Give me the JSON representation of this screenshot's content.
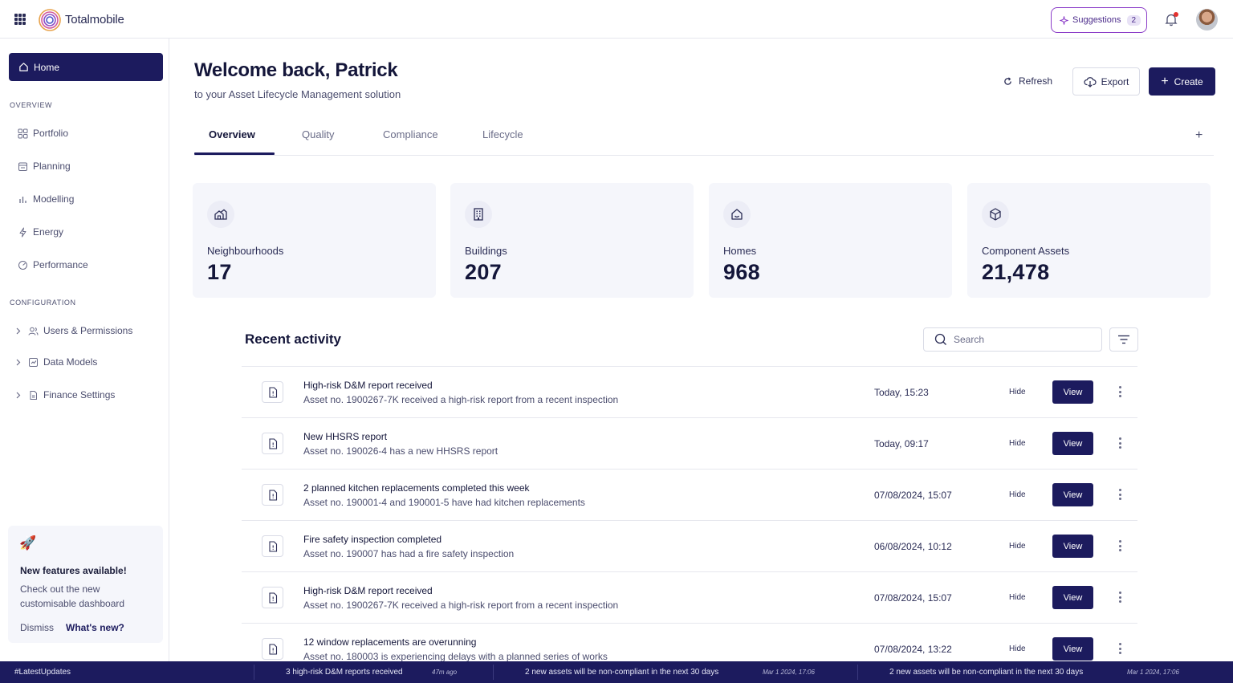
{
  "app": {
    "brand": "Totalmobile"
  },
  "topbar": {
    "suggestions_label": "Suggestions",
    "suggestions_count": "2"
  },
  "sidebar": {
    "home_label": "Home",
    "overview_heading": "OVERVIEW",
    "overview_items": [
      {
        "label": "Portfolio",
        "icon": "grid-icon"
      },
      {
        "label": "Planning",
        "icon": "calendar-icon"
      },
      {
        "label": "Modelling",
        "icon": "bar-chart-icon"
      },
      {
        "label": "Energy",
        "icon": "lightning-icon"
      },
      {
        "label": "Performance",
        "icon": "gauge-icon"
      }
    ],
    "configuration_heading": "CONFIGURATION",
    "configuration_items": [
      {
        "label": "Users & Permissions",
        "icon": "users-icon"
      },
      {
        "label": "Data Models",
        "icon": "data-model-icon"
      },
      {
        "label": "Finance Settings",
        "icon": "document-icon"
      }
    ],
    "promo": {
      "title": "New features available!",
      "text": "Check out the new customisable dashboard",
      "dismiss_label": "Dismiss",
      "whats_new_label": "What's new?"
    }
  },
  "header": {
    "title": "Welcome back, Patrick",
    "subtitle": "to your Asset Lifecycle Management solution",
    "refresh_label": "Refresh",
    "export_label": "Export",
    "create_label": "Create"
  },
  "tabs": [
    {
      "label": "Overview",
      "active": true
    },
    {
      "label": "Quality",
      "active": false
    },
    {
      "label": "Compliance",
      "active": false
    },
    {
      "label": "Lifecycle",
      "active": false
    }
  ],
  "stats": [
    {
      "label": "Neighbourhoods",
      "value": "17",
      "icon": "neighbourhood-icon"
    },
    {
      "label": "Buildings",
      "value": "207",
      "icon": "building-icon"
    },
    {
      "label": "Homes",
      "value": "968",
      "icon": "home-icon"
    },
    {
      "label": "Component Assets",
      "value": "21,478",
      "icon": "cube-icon"
    }
  ],
  "activity": {
    "title": "Recent activity",
    "search_placeholder": "Search",
    "hide_label": "Hide",
    "view_label": "View",
    "rows": [
      {
        "title": "High-risk D&M report received",
        "desc": "Asset no. 1900267-7K received a high-risk report from a recent inspection",
        "time": "Today, 15:23"
      },
      {
        "title": "New HHSRS report",
        "desc": "Asset no. 190026-4 has a new HHSRS report",
        "time": "Today, 09:17"
      },
      {
        "title": "2 planned kitchen replacements completed this week",
        "desc": "Asset no. 190001-4 and 190001-5 have had kitchen replacements",
        "time": "07/08/2024, 15:07"
      },
      {
        "title": "Fire safety inspection completed",
        "desc": "Asset no. 190007 has had a fire safety inspection",
        "time": "06/08/2024, 10:12"
      },
      {
        "title": "High-risk D&M report received",
        "desc": "Asset no. 1900267-7K received a high-risk report from a recent inspection",
        "time": "07/08/2024, 15:07"
      },
      {
        "title": "12 window replacements are overunning",
        "desc": "Asset no. 180003 is experiencing delays with a planned series of works",
        "time": "07/08/2024, 13:22"
      }
    ]
  },
  "ticker": {
    "tag": "#LatestUpdates",
    "items": [
      {
        "message": "3 high-risk D&M reports received",
        "time": "47m ago"
      },
      {
        "message": "2 new assets will be non-compliant in the next 30 days",
        "time": "Mar 1 2024, 17:06"
      },
      {
        "message": "2 new assets will be non-compliant in the next 30 days",
        "time": "Mar 1 2024, 17:06"
      }
    ]
  },
  "colors": {
    "primary": "#1c1b5e",
    "accent_purple": "#8b3dc8",
    "card_bg": "#f5f6fb",
    "notification": "#e3312f"
  }
}
